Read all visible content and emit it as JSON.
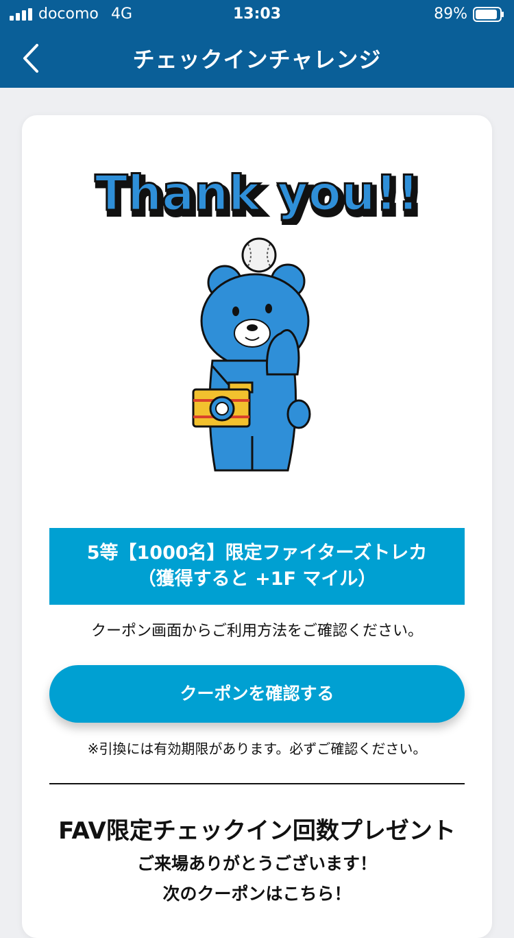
{
  "status_bar": {
    "carrier": "docomo",
    "network": "4G",
    "time": "13:03",
    "battery": "89%"
  },
  "nav": {
    "title": "チェックインチャレンジ"
  },
  "card": {
    "thanks_text": "Thank you!!",
    "prize_line1": "5等【1000名】限定ファイターズトレカ",
    "prize_line2": "（獲得すると +1F マイル）",
    "coupon_note": "クーポン画面からご利用方法をご確認ください。",
    "coupon_button": "クーポンを確認する",
    "expiry_note": "※引換には有効期限があります。必ずご確認ください。",
    "section_title": "FAV限定チェックイン回数プレゼント",
    "section_line1": "ご来場ありがとうございます！",
    "section_line2": "次のクーポンはこちら！"
  },
  "colors": {
    "header": "#0a5f98",
    "accent": "#00a0d2",
    "background": "#eeeff2"
  }
}
